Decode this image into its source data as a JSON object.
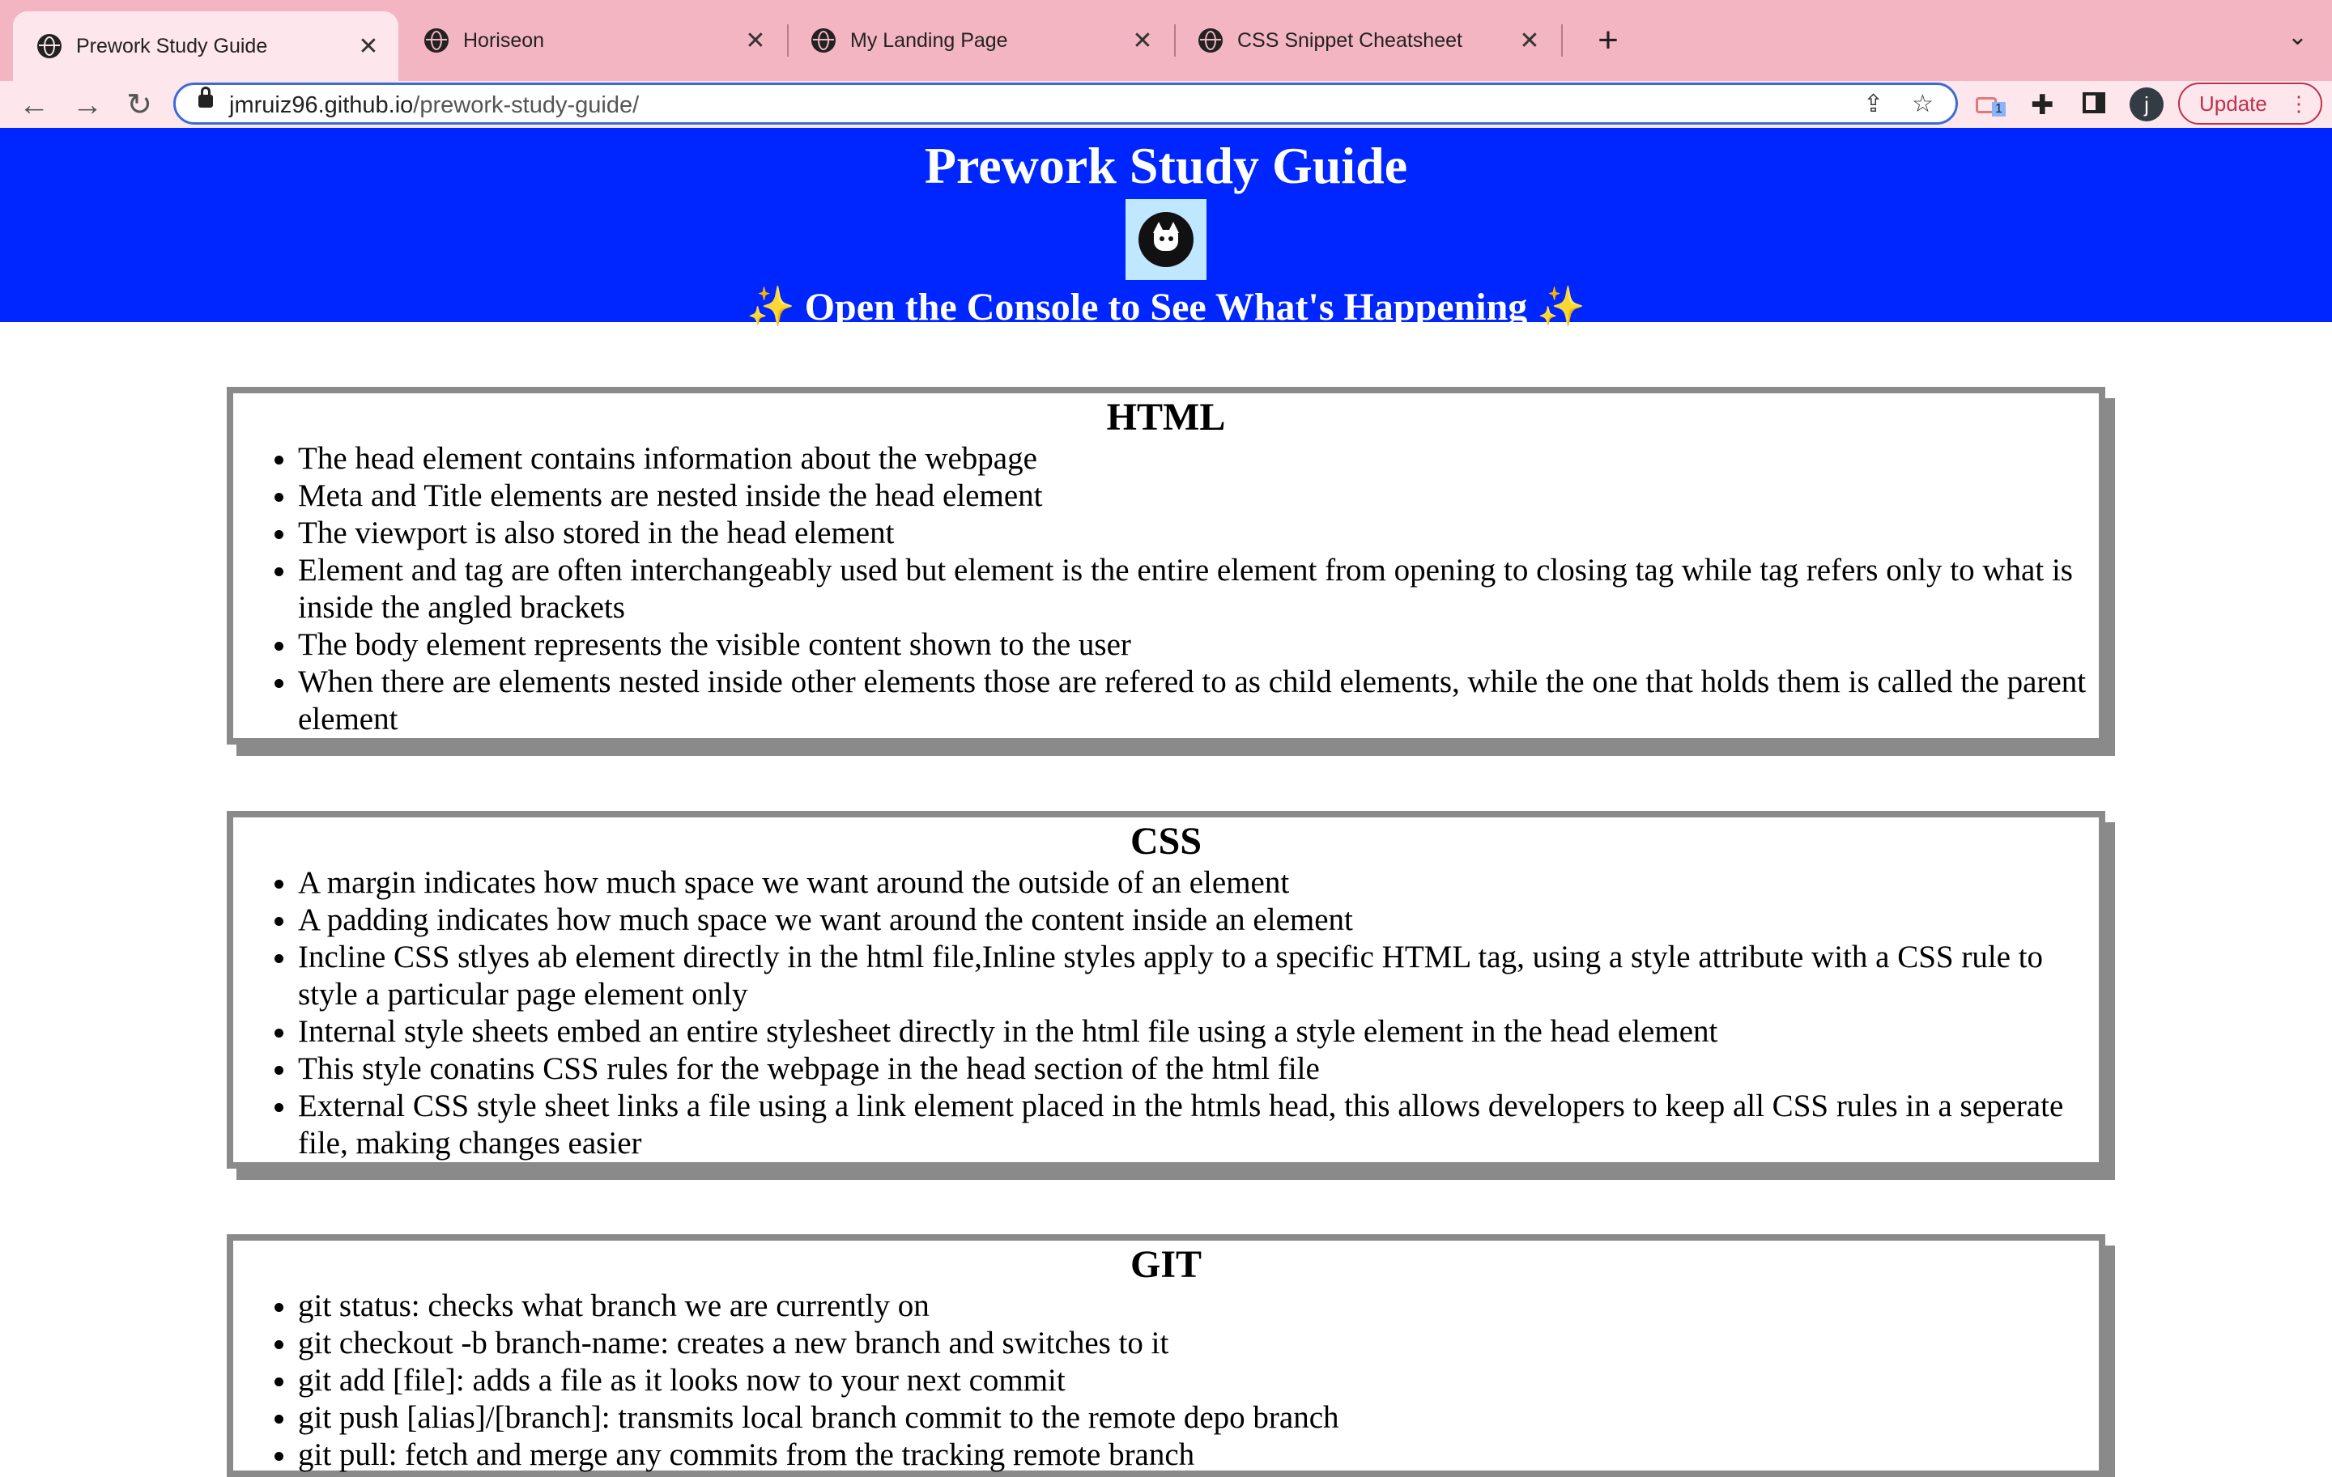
{
  "browser": {
    "tabs": [
      {
        "title": "Prework Study Guide",
        "active": true
      },
      {
        "title": "Horiseon",
        "active": false
      },
      {
        "title": "My Landing Page",
        "active": false
      },
      {
        "title": "CSS Snippet Cheatsheet",
        "active": false
      }
    ],
    "close_glyph": "✕",
    "new_tab_glyph": "+",
    "tab_menu_glyph": "⌄",
    "url_host": "jmruiz96.github.io",
    "url_path": "/prework-study-guide/",
    "profile_initial": "j",
    "extension_badge": "1",
    "update_label": "Update"
  },
  "page": {
    "title": "Prework Study Guide",
    "subtitle": "Open the Console to See What's Happening",
    "sparkle": "✨",
    "sections": [
      {
        "heading": "HTML",
        "items": [
          "The head element contains information about the webpage",
          "Meta and Title elements are nested inside the head element",
          "The viewport is also stored in the head element",
          "Element and tag are often interchangeably used but element is the entire element from opening to closing tag while tag refers only to what is inside the angled brackets",
          "The body element represents the visible content shown to the user",
          "When there are elements nested inside other elements those are refered to as child elements, while the one that holds them is called the parent element"
        ]
      },
      {
        "heading": "CSS",
        "items": [
          "A margin indicates how much space we want around the outside of an element",
          "A padding indicates how much space we want around the content inside an element",
          "Incline CSS stlyes ab element directly in the html file,Inline styles apply to a specific HTML tag, using a style attribute with a CSS rule to style a particular page element only",
          "Internal style sheets embed an entire stylesheet directly in the html file using a style element in the head element",
          "This style conatins CSS rules for the webpage in the head section of the html file",
          "External CSS style sheet links a file using a link element placed in the htmls head, this allows developers to keep all CSS rules in a seperate file, making changes easier"
        ]
      },
      {
        "heading": "GIT",
        "items": [
          "git status: checks what branch we are currently on",
          "git checkout -b branch-name: creates a new branch and switches to it",
          "git add [file]: adds a file as it looks now to your next commit",
          "git push [alias]/[branch]: transmits local branch commit to the remote depo branch",
          "git pull: fetch and merge any commits from the tracking remote branch"
        ]
      }
    ]
  },
  "colors": {
    "tab_strip": "#f4b5c3",
    "active_tab": "#fde7ec",
    "hero_background": "#0026ff",
    "card_border": "#8a8a8a"
  },
  "icons": [
    "globe-icon",
    "close-icon",
    "plus-icon",
    "back-arrow-icon",
    "forward-arrow-icon",
    "reload-icon",
    "lock-icon",
    "share-icon",
    "star-icon",
    "extension-icon",
    "puzzle-icon",
    "side-panel-icon",
    "kebab-menu-icon"
  ]
}
